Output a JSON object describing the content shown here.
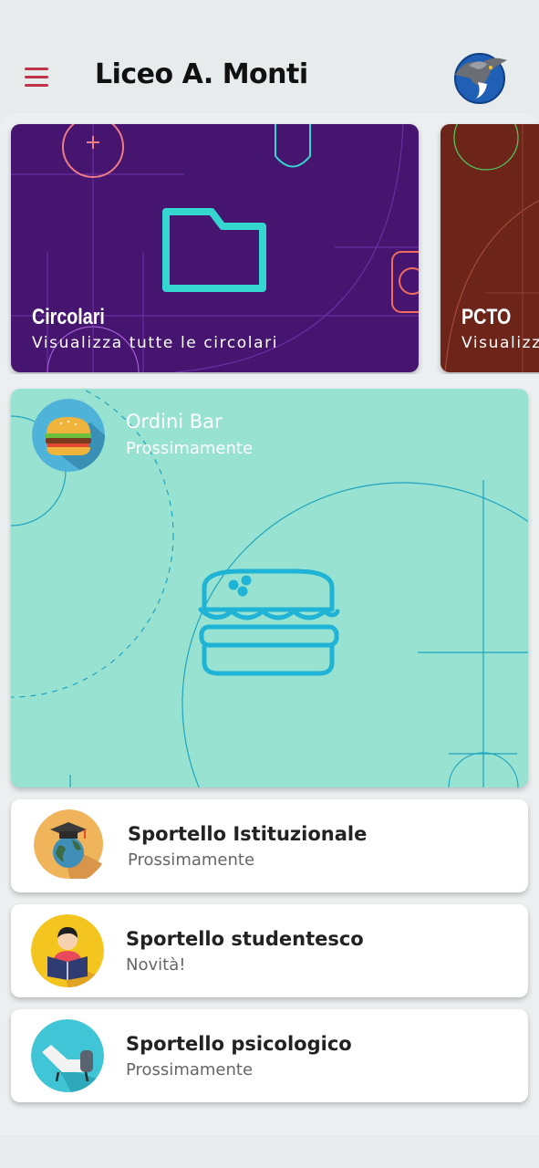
{
  "header": {
    "title": "Liceo A. Monti",
    "menu_icon": "hamburger-menu-icon",
    "logo_icon": "eagle-logo-icon"
  },
  "colors": {
    "accent": "#c2324a",
    "circolari_bg": "#45156f",
    "pcto_bg": "#6d2419",
    "bar_bg": "#98e2d1",
    "list_bg": "#ffffff"
  },
  "carousel": [
    {
      "title": "Circolari",
      "subtitle": "Visualizza tutte le circolari",
      "icon": "folder-icon"
    },
    {
      "title": "PCTO",
      "subtitle": "Visualizza",
      "icon": "pcto-icon"
    }
  ],
  "bar": {
    "title": "Ordini Bar",
    "subtitle": "Prossimamente",
    "icon": "burger-icon"
  },
  "services": [
    {
      "title": "Sportello Istituzionale",
      "subtitle": "Prossimamente",
      "icon": "graduation-globe-icon"
    },
    {
      "title": "Sportello studentesco",
      "subtitle": "Novità!",
      "icon": "student-reading-icon"
    },
    {
      "title": "Sportello psicologico",
      "subtitle": "Prossimamente",
      "icon": "therapy-couch-icon"
    }
  ]
}
